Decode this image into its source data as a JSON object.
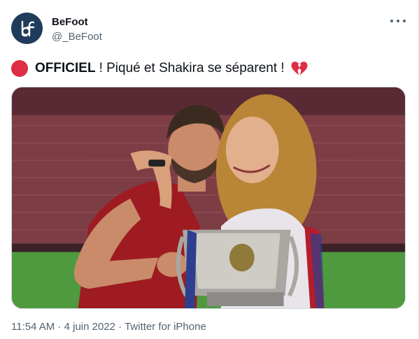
{
  "author": {
    "display_name": "BeFoot",
    "handle": "@_BeFoot",
    "avatar_letters": "bf"
  },
  "tweet": {
    "emoji_start": "red-circle",
    "strong_text": "OFFICIEL",
    "rest_text": "! Piqué et Shakira se séparent !",
    "emoji_end": "broken-heart"
  },
  "meta": {
    "time": "11:54 AM",
    "separator": " · ",
    "date": "4 juin 2022",
    "source": "Twitter for iPhone"
  },
  "colors": {
    "text_primary": "#0f1419",
    "text_secondary": "#536471",
    "avatar_bg": "#1f3b5c",
    "red_circle": "#dd2e44"
  }
}
